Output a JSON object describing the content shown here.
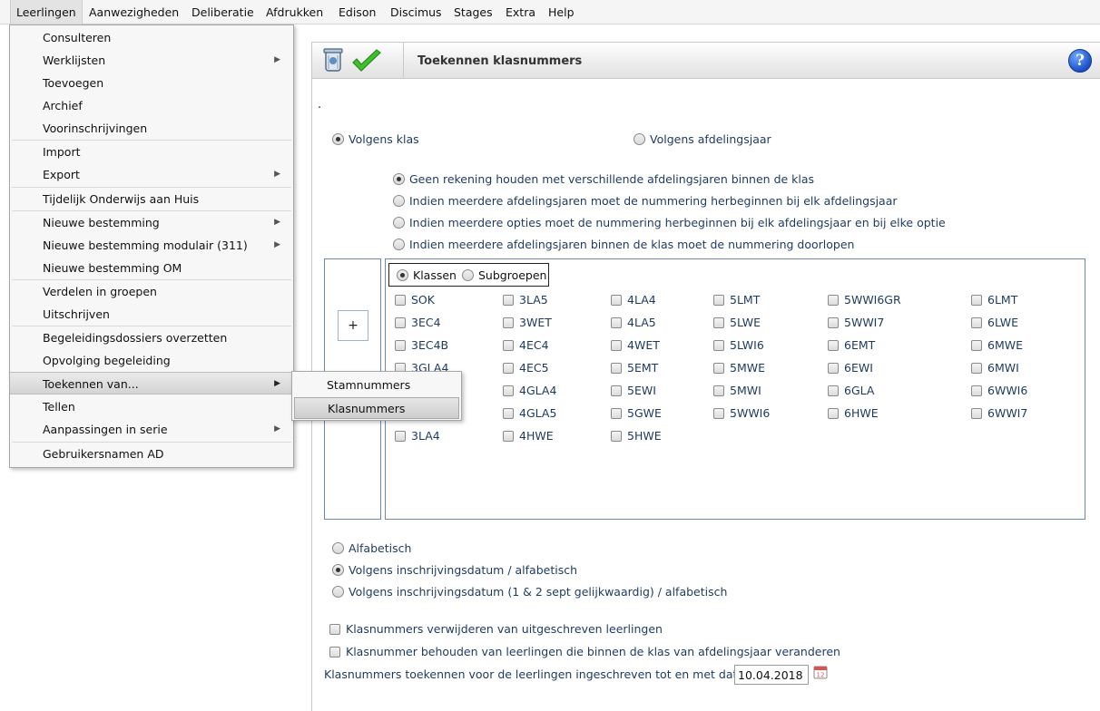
{
  "menubar": {
    "items": [
      "Leerlingen",
      "Aanwezigheden",
      "Deliberatie",
      "Afdrukken",
      "Edison",
      "Discimus",
      "Stages",
      "Extra",
      "Help"
    ]
  },
  "dropdown": {
    "items": [
      {
        "label": "Consulteren",
        "submenu": false
      },
      {
        "label": "Werklijsten",
        "submenu": true
      },
      {
        "label": "Toevoegen",
        "submenu": false
      },
      {
        "label": "Archief",
        "submenu": false
      },
      {
        "label": "Voorinschrijvingen",
        "submenu": false
      },
      {
        "label": "Import",
        "submenu": false
      },
      {
        "label": "Export",
        "submenu": true
      },
      {
        "label": "Tijdelijk Onderwijs aan Huis",
        "submenu": false
      },
      {
        "label": "Nieuwe bestemming",
        "submenu": true
      },
      {
        "label": "Nieuwe bestemming modulair (311)",
        "submenu": true
      },
      {
        "label": "Nieuwe bestemming OM",
        "submenu": false
      },
      {
        "label": "Verdelen in groepen",
        "submenu": false
      },
      {
        "label": "Uitschrijven",
        "submenu": false
      },
      {
        "label": "Begeleidingsdossiers overzetten",
        "submenu": false
      },
      {
        "label": "Opvolging begeleiding",
        "submenu": false
      },
      {
        "label": "Toekennen van...",
        "submenu": true
      },
      {
        "label": "Tellen",
        "submenu": false
      },
      {
        "label": "Aanpassingen in serie",
        "submenu": true
      },
      {
        "label": "Gebruikersnamen AD",
        "submenu": false
      }
    ]
  },
  "submenu": {
    "items": [
      "Stamnummers",
      "Klasnummers"
    ]
  },
  "panel": {
    "title": "Toekennen klasnummers",
    "help_icon": "?",
    "dot": "."
  },
  "mode": {
    "volgens_klas": "Volgens klas",
    "volgens_afdelingsjaar": "Volgens afdelingsjaar",
    "selected": "Volgens klas"
  },
  "numbering_options": [
    {
      "label": "Geen rekening houden met verschillende afdelingsjaren binnen de klas",
      "checked": true
    },
    {
      "label": "Indien meerdere afdelingsjaren moet de nummering herbeginnen bij elk afdelingsjaar",
      "checked": false
    },
    {
      "label": "Indien meerdere opties moet de nummering herbeginnen bij elk afdelingsjaar en bij elke optie",
      "checked": false
    },
    {
      "label": "Indien meerdere afdelingsjaren binnen de klas moet de nummering doorlopen",
      "checked": false
    }
  ],
  "grid": {
    "plus": "+",
    "klassen": "Klassen",
    "subgroepen": "Subgroepen",
    "columns": [
      [
        "SOK",
        "3EC4",
        "3EC4B",
        "3GLA4",
        "",
        "",
        "3LA4"
      ],
      [
        "3LA5",
        "3WET",
        "4EC4",
        "4EC5",
        "4GLA4",
        "4GLA5",
        "4HWE"
      ],
      [
        "4LA4",
        "4LA5",
        "4WET",
        "5EMT",
        "5EWI",
        "5GWE",
        "5HWE"
      ],
      [
        "5LMT",
        "5LWE",
        "5LWI6",
        "5MWE",
        "5MWI",
        "5WWI6"
      ],
      [
        "5WWI6GR",
        "5WWI7",
        "6EMT",
        "6EWI",
        "6GLA",
        "6HWE"
      ],
      [
        "6LMT",
        "6LWE",
        "6MWE",
        "6MWI",
        "6WWI6",
        "6WWI7"
      ]
    ]
  },
  "sort_options": [
    {
      "label": "Alfabetisch",
      "checked": false
    },
    {
      "label": "Volgens inschrijvingsdatum / alfabetisch",
      "checked": true
    },
    {
      "label": "Volgens inschrijvingsdatum (1 & 2 sept gelijkwaardig) / alfabetisch",
      "checked": false
    }
  ],
  "checkboxes": [
    {
      "label": "Klasnummers verwijderen van uitgeschreven leerlingen",
      "checked": false
    },
    {
      "label": "Klasnummer behouden van leerlingen die binnen de klas van afdelingsjaar veranderen",
      "checked": false
    }
  ],
  "date": {
    "label": "Klasnummers toekennen voor de leerlingen ingeschreven tot en met datum",
    "value": "10.04.2018",
    "calendar_day": "12"
  }
}
